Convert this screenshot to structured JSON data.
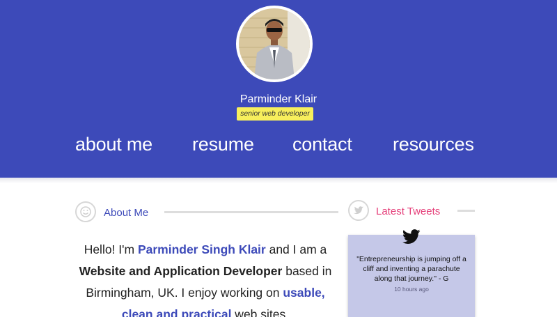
{
  "profile": {
    "name": "Parminder Klair",
    "tagline": "senior web developer"
  },
  "nav": {
    "items": [
      {
        "label": "about me"
      },
      {
        "label": "resume"
      },
      {
        "label": "contact"
      },
      {
        "label": "resources"
      }
    ]
  },
  "about": {
    "title": "About Me",
    "icon": "smiley-icon",
    "text": {
      "p1": "Hello! I'm ",
      "name": "Parminder Singh Klair",
      "p2": " and I am a ",
      "role": "Website and Application Developer",
      "p3": " based in Birmingham, UK. I enjoy working on ",
      "focus": "usable, clean and practical",
      "p4": " web sites."
    }
  },
  "tweets": {
    "title": "Latest Tweets",
    "icon": "twitter-icon",
    "items": [
      {
        "text": "\"Entrepreneurship is jumping off a cliff and inventing a parachute along that journey.\" - G",
        "time": "10 hours ago"
      }
    ]
  },
  "colors": {
    "brand": "#3d4ab9",
    "accent_pink": "#e5407a",
    "tagline_bg": "#f7ef5c",
    "tweet_card_bg": "#c5c8e8"
  }
}
